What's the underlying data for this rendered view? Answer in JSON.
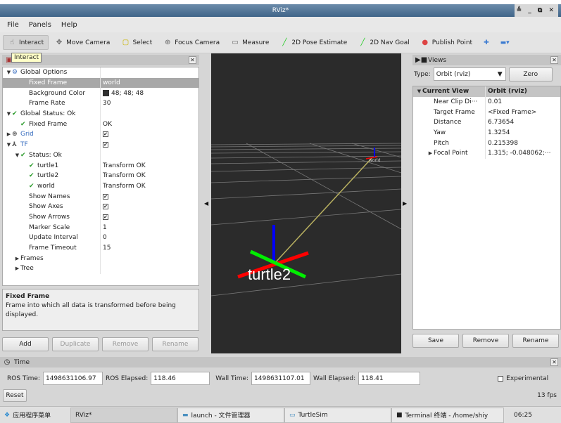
{
  "window": {
    "title": "RViz*",
    "controls": "≜ _ ⧉ ✕"
  },
  "menu": [
    "File",
    "Panels",
    "Help"
  ],
  "toolbar": [
    {
      "label": "Interact",
      "icon": "hand-icon",
      "active": true
    },
    {
      "label": "Move Camera",
      "icon": "move-camera-icon"
    },
    {
      "label": "Select",
      "icon": "select-icon"
    },
    {
      "label": "Focus Camera",
      "icon": "focus-camera-icon"
    },
    {
      "label": "Measure",
      "icon": "ruler-icon"
    },
    {
      "label": "2D Pose Estimate",
      "icon": "green-arrow-icon"
    },
    {
      "label": "2D Nav Goal",
      "icon": "green-arrow-icon"
    },
    {
      "label": "Publish Point",
      "icon": "map-pin-icon"
    }
  ],
  "tooltip": "Interact",
  "displays": {
    "rows": [
      {
        "name": "Global Options",
        "value": "",
        "indent": 0,
        "arrow": "▼",
        "icon": "gear"
      },
      {
        "name": "Fixed Frame",
        "value": "world",
        "indent": 2,
        "selected": true
      },
      {
        "name": "Background Color",
        "value": "48; 48; 48",
        "indent": 2,
        "swatch": "#303030"
      },
      {
        "name": "Frame Rate",
        "value": "30",
        "indent": 2
      },
      {
        "name": "Global Status: Ok",
        "value": "",
        "indent": 0,
        "arrow": "▼",
        "icon": "check"
      },
      {
        "name": "Fixed Frame",
        "value": "OK",
        "indent": 1,
        "icon": "check"
      },
      {
        "name": "Grid",
        "value": "",
        "indent": 0,
        "arrow": "▶",
        "icon": "grid",
        "blue": true,
        "checkbox": true
      },
      {
        "name": "TF",
        "value": "",
        "indent": 0,
        "arrow": "▼",
        "icon": "tf",
        "blue": true,
        "checkbox": true
      },
      {
        "name": "Status: Ok",
        "value": "",
        "indent": 1,
        "arrow": "▼",
        "icon": "check"
      },
      {
        "name": "turtle1",
        "value": "Transform OK",
        "indent": 2,
        "icon": "check"
      },
      {
        "name": "turtle2",
        "value": "Transform OK",
        "indent": 2,
        "icon": "check"
      },
      {
        "name": "world",
        "value": "Transform OK",
        "indent": 2,
        "icon": "check"
      },
      {
        "name": "Show Names",
        "value": "",
        "indent": 2,
        "checkbox": true
      },
      {
        "name": "Show Axes",
        "value": "",
        "indent": 2,
        "checkbox": true
      },
      {
        "name": "Show Arrows",
        "value": "",
        "indent": 2,
        "checkbox": true
      },
      {
        "name": "Marker Scale",
        "value": "1",
        "indent": 2
      },
      {
        "name": "Update Interval",
        "value": "0",
        "indent": 2
      },
      {
        "name": "Frame Timeout",
        "value": "15",
        "indent": 2
      },
      {
        "name": "Frames",
        "value": "",
        "indent": 1,
        "arrow": "▶"
      },
      {
        "name": "Tree",
        "value": "",
        "indent": 1,
        "arrow": "▶"
      }
    ],
    "description_title": "Fixed Frame",
    "description": "Frame into which all data is transformed before being displayed.",
    "buttons": {
      "add": "Add",
      "duplicate": "Duplicate",
      "remove": "Remove",
      "rename": "Rename"
    }
  },
  "scene": {
    "labels": {
      "turtle2": "turtle2",
      "world": "world"
    }
  },
  "views": {
    "title": "Views",
    "type_label": "Type:",
    "type_value": "Orbit (rviz)",
    "zero": "Zero",
    "header": {
      "name": "Current View",
      "value": "Orbit (rviz)"
    },
    "rows": [
      {
        "name": "Near Clip Di···",
        "value": "0.01"
      },
      {
        "name": "Target Frame",
        "value": "<Fixed Frame>"
      },
      {
        "name": "Distance",
        "value": "6.73654"
      },
      {
        "name": "Yaw",
        "value": "1.3254"
      },
      {
        "name": "Pitch",
        "value": "0.215398"
      },
      {
        "name": "Focal Point",
        "value": "1.315; -0.048062;···",
        "arrow": "▶"
      }
    ],
    "buttons": {
      "save": "Save",
      "remove": "Remove",
      "rename": "Rename"
    }
  },
  "time": {
    "title": "Time",
    "ros_time_label": "ROS Time:",
    "ros_time": "1498631106.97",
    "ros_elapsed_label": "ROS Elapsed:",
    "ros_elapsed": "118.46",
    "wall_time_label": "Wall Time:",
    "wall_time": "1498631107.01",
    "wall_elapsed_label": "Wall Elapsed:",
    "wall_elapsed": "118.41",
    "experimental": "Experimental",
    "reset": "Reset",
    "fps": "13 fps"
  },
  "taskbar": {
    "menu": "应用程序菜单",
    "tasks": [
      "RViz*",
      "launch - 文件管理器",
      "TurtleSim",
      "Terminal 终端 - /home/shiy"
    ],
    "clock": "06:25"
  }
}
